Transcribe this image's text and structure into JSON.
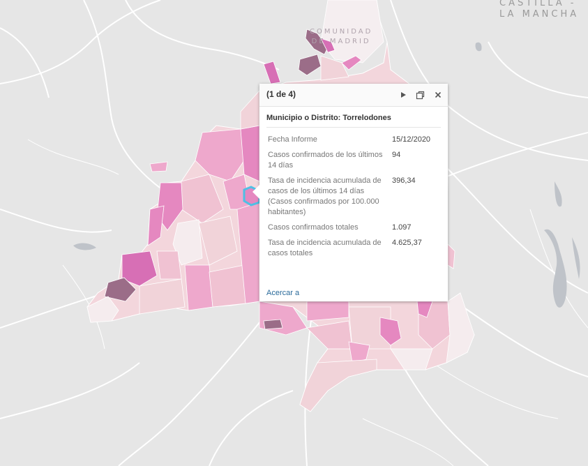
{
  "map": {
    "labels": {
      "region_top_right": [
        "CASTILLA -",
        "LA MANCHA"
      ],
      "region_center": [
        "COMUNIDAD",
        "DE MADRID"
      ]
    },
    "colors": {
      "background": "#e6e6e6",
      "road": "#ffffff",
      "water": "#bfc3c9",
      "very_low": "#f5ecee",
      "low": "#f1d3d9",
      "mid_low": "#f0c2d2",
      "mid": "#eea8cc",
      "high": "#e588c0",
      "very_high": "#d76fb5",
      "extreme": "#9b6d88",
      "selected_outline": "#4ec0e4"
    }
  },
  "popup": {
    "feature_count": "(1 de 4)",
    "title": "Municipio o Distrito: Torrelodones",
    "rows": [
      {
        "label": "Fecha Informe",
        "value": "15/12/2020"
      },
      {
        "label": "Casos confirmados de los últimos 14 días",
        "value": "94"
      },
      {
        "label": "Tasa de incidencia acumulada de casos de los últimos 14 días (Casos confirmados por 100.000 habitantes)",
        "value": "396,34"
      },
      {
        "label": "Casos confirmados totales",
        "value": "1.097"
      },
      {
        "label": "Tasa de incidencia acumulada de casos totales",
        "value": "4.625,37"
      }
    ],
    "zoom_label": "Acercar a",
    "icons": {
      "next": "play-icon",
      "dock": "dock-icon",
      "close": "close-icon"
    }
  }
}
